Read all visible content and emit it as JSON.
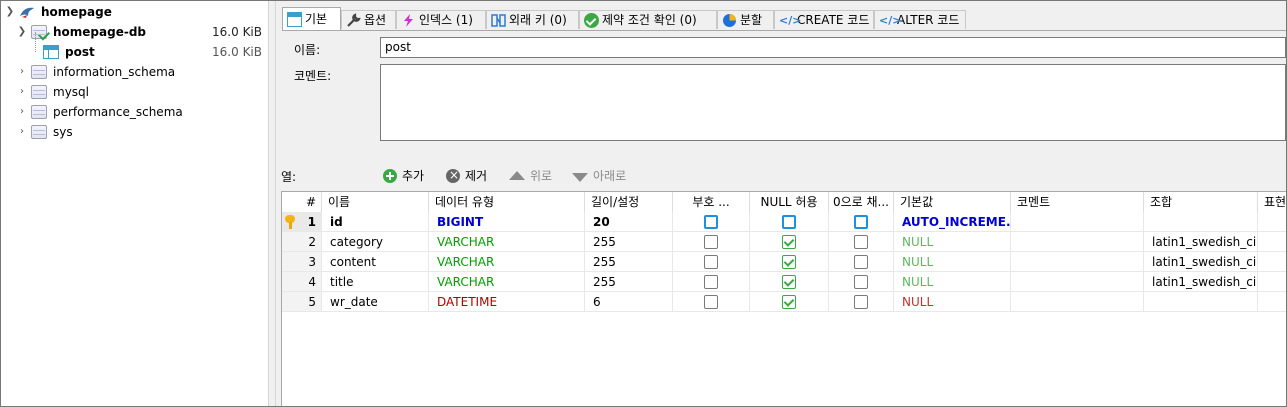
{
  "tree": {
    "root": {
      "label": "homepage"
    },
    "db": {
      "label": "homepage-db",
      "size": "16.0 KiB"
    },
    "table": {
      "label": "post",
      "size": "16.0 KiB"
    },
    "schemas": [
      {
        "label": "information_schema"
      },
      {
        "label": "mysql"
      },
      {
        "label": "performance_schema"
      },
      {
        "label": "sys"
      }
    ]
  },
  "tabs": [
    {
      "label": "기본",
      "icon": "table-icon"
    },
    {
      "label": "옵션",
      "icon": "wrench-icon"
    },
    {
      "label": "인덱스 (1)",
      "icon": "lightning-icon"
    },
    {
      "label": "외래 키 (0)",
      "icon": "foreign-key-icon"
    },
    {
      "label": "제약 조건 확인 (0)",
      "icon": "check-circle-icon"
    },
    {
      "label": "분할",
      "icon": "pie-icon"
    },
    {
      "label": "CREATE 코드",
      "icon": "code-icon"
    },
    {
      "label": "ALTER 코드",
      "icon": "code-icon"
    }
  ],
  "form": {
    "name_label": "이름:",
    "name_value": "post",
    "comment_label": "코멘트:"
  },
  "columns_toolbar": {
    "label": "열:",
    "add": "추가",
    "remove": "제거",
    "up": "위로",
    "down": "아래로"
  },
  "grid": {
    "headers": [
      "#",
      "이름",
      "데이터 유형",
      "길이/설정",
      "부호 ...",
      "NULL 허용",
      "0으로 채...",
      "기본값",
      "코멘트",
      "조합",
      "표현"
    ],
    "rows": [
      {
        "num": "1",
        "name": "id",
        "type": "BIGINT",
        "length": "20",
        "unsigned": false,
        "nullable": false,
        "zerofill": false,
        "default": "AUTO_INCREME...",
        "comment": "",
        "collation": "",
        "pk": true
      },
      {
        "num": "2",
        "name": "category",
        "type": "VARCHAR",
        "length": "255",
        "unsigned": false,
        "nullable": true,
        "zerofill": false,
        "default": "NULL",
        "comment": "",
        "collation": "latin1_swedish_ci",
        "pk": false
      },
      {
        "num": "3",
        "name": "content",
        "type": "VARCHAR",
        "length": "255",
        "unsigned": false,
        "nullable": true,
        "zerofill": false,
        "default": "NULL",
        "comment": "",
        "collation": "latin1_swedish_ci",
        "pk": false
      },
      {
        "num": "4",
        "name": "title",
        "type": "VARCHAR",
        "length": "255",
        "unsigned": false,
        "nullable": true,
        "zerofill": false,
        "default": "NULL",
        "comment": "",
        "collation": "latin1_swedish_ci",
        "pk": false
      },
      {
        "num": "5",
        "name": "wr_date",
        "type": "DATETIME",
        "length": "6",
        "unsigned": false,
        "nullable": true,
        "zerofill": false,
        "default": "NULL",
        "comment": "",
        "collation": "",
        "pk": false
      }
    ]
  },
  "colors": {
    "int_type": "#0000d0",
    "varchar_type": "#00a000",
    "datetime_type": "#b00000",
    "null_default": "#5cb85c",
    "null_default_dt": "#c03030",
    "auto_inc": "#0000d0"
  }
}
